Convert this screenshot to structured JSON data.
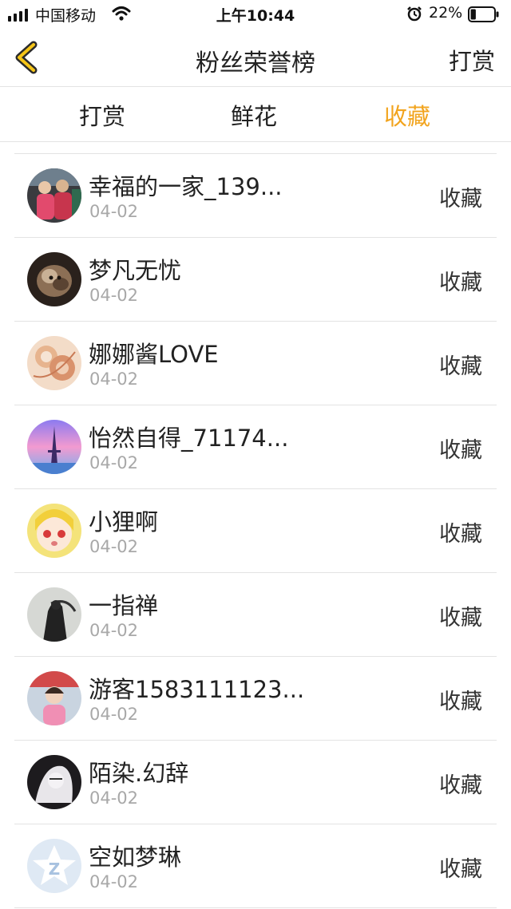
{
  "status_bar": {
    "carrier": "中国移动",
    "time": "上午10:44",
    "battery": "22%",
    "battery_level": 0.22
  },
  "header": {
    "title": "粉丝荣誉榜",
    "right_action": "打赏"
  },
  "tabs": [
    {
      "label": "打赏",
      "active": false
    },
    {
      "label": "鲜花",
      "active": false
    },
    {
      "label": "收藏",
      "active": true
    }
  ],
  "accent_color": "#f2a41e",
  "fans": [
    {
      "name": "幸福的一家_139...",
      "date": "04-02",
      "action": "收藏"
    },
    {
      "name": "梦凡无忧",
      "date": "04-02",
      "action": "收藏"
    },
    {
      "name": "娜娜酱LOVE",
      "date": "04-02",
      "action": "收藏"
    },
    {
      "name": "怡然自得_71174...",
      "date": "04-02",
      "action": "收藏"
    },
    {
      "name": "小狸啊",
      "date": "04-02",
      "action": "收藏"
    },
    {
      "name": "一指禅",
      "date": "04-02",
      "action": "收藏"
    },
    {
      "name": "游客1583111123...",
      "date": "04-02",
      "action": "收藏"
    },
    {
      "name": "陌染.幻辞",
      "date": "04-02",
      "action": "收藏"
    },
    {
      "name": "空如梦琳",
      "date": "04-02",
      "action": "收藏"
    }
  ]
}
